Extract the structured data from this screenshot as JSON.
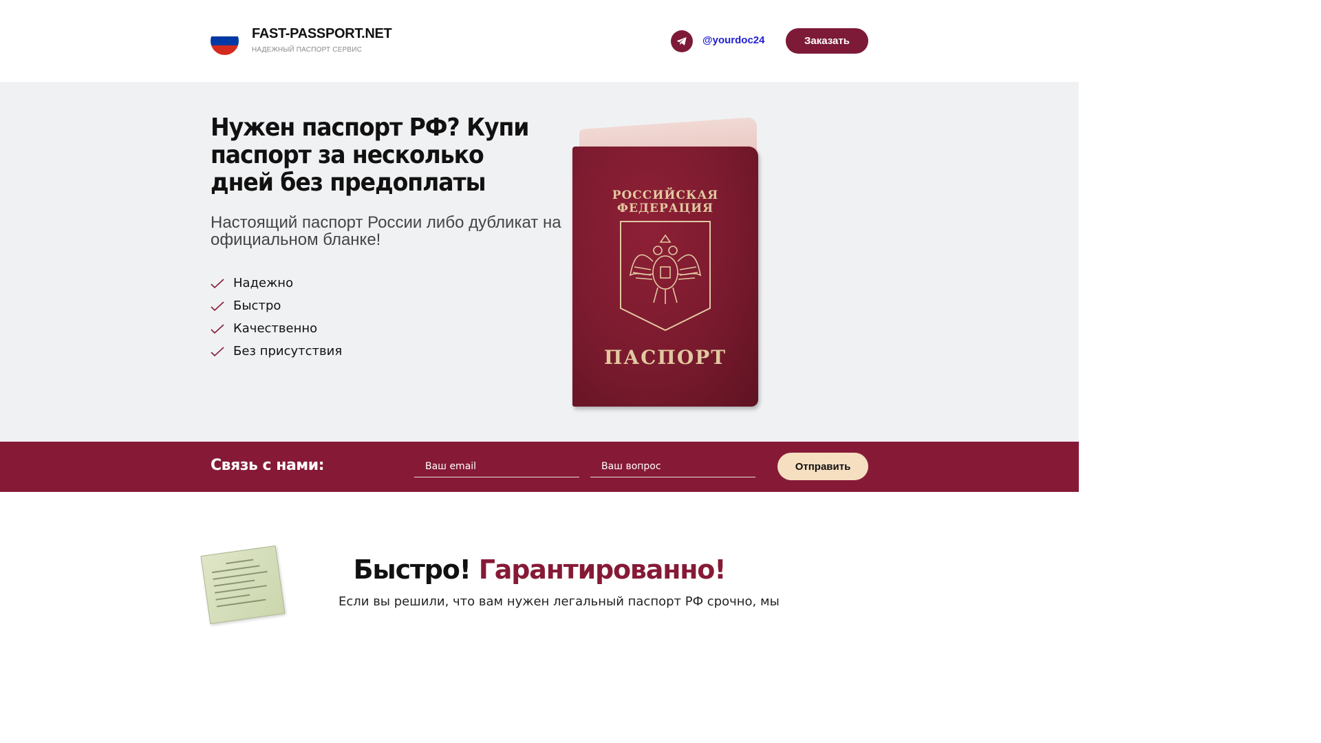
{
  "header": {
    "brand_title": "FAST-PASSPORT.NET",
    "brand_subtitle": "НАДЕЖНЫЙ ПАСПОРТ СЕРВИС",
    "telegram_handle": "@yourdoc24",
    "order_button": "Заказать",
    "flag_colors": [
      "#ffffff",
      "#0039a6",
      "#d52b1e"
    ],
    "icons": [
      "russia-flag-icon",
      "telegram-icon"
    ]
  },
  "hero": {
    "title": "Нужен паспорт РФ? Купи паспорт за несколько дней без предоплаты",
    "subtitle": "Настоящий паспорт России либо дубликат на официальном бланке!",
    "features": [
      "Надежно",
      "Быстро",
      "Качественно",
      "Без присутствия"
    ],
    "passport_country": "РОССИЙСКАЯ ФЕДЕРАЦИЯ",
    "passport_word": "ПАСПОРТ"
  },
  "contact": {
    "title": "Связь с нами:",
    "email_placeholder": "Ваш email",
    "question_placeholder": "Ваш вопрос",
    "send_button": "Отправить"
  },
  "lower": {
    "title_part1": "Быстро!",
    "title_part2": "Гарантированно!",
    "text": "Если вы решили, что вам нужен легальный паспорт РФ срочно, мы"
  },
  "colors": {
    "accent": "#861a36",
    "hero_bg": "#f0f1f3",
    "send_button_bg": "#f6dfc1",
    "link": "#2020d0"
  }
}
